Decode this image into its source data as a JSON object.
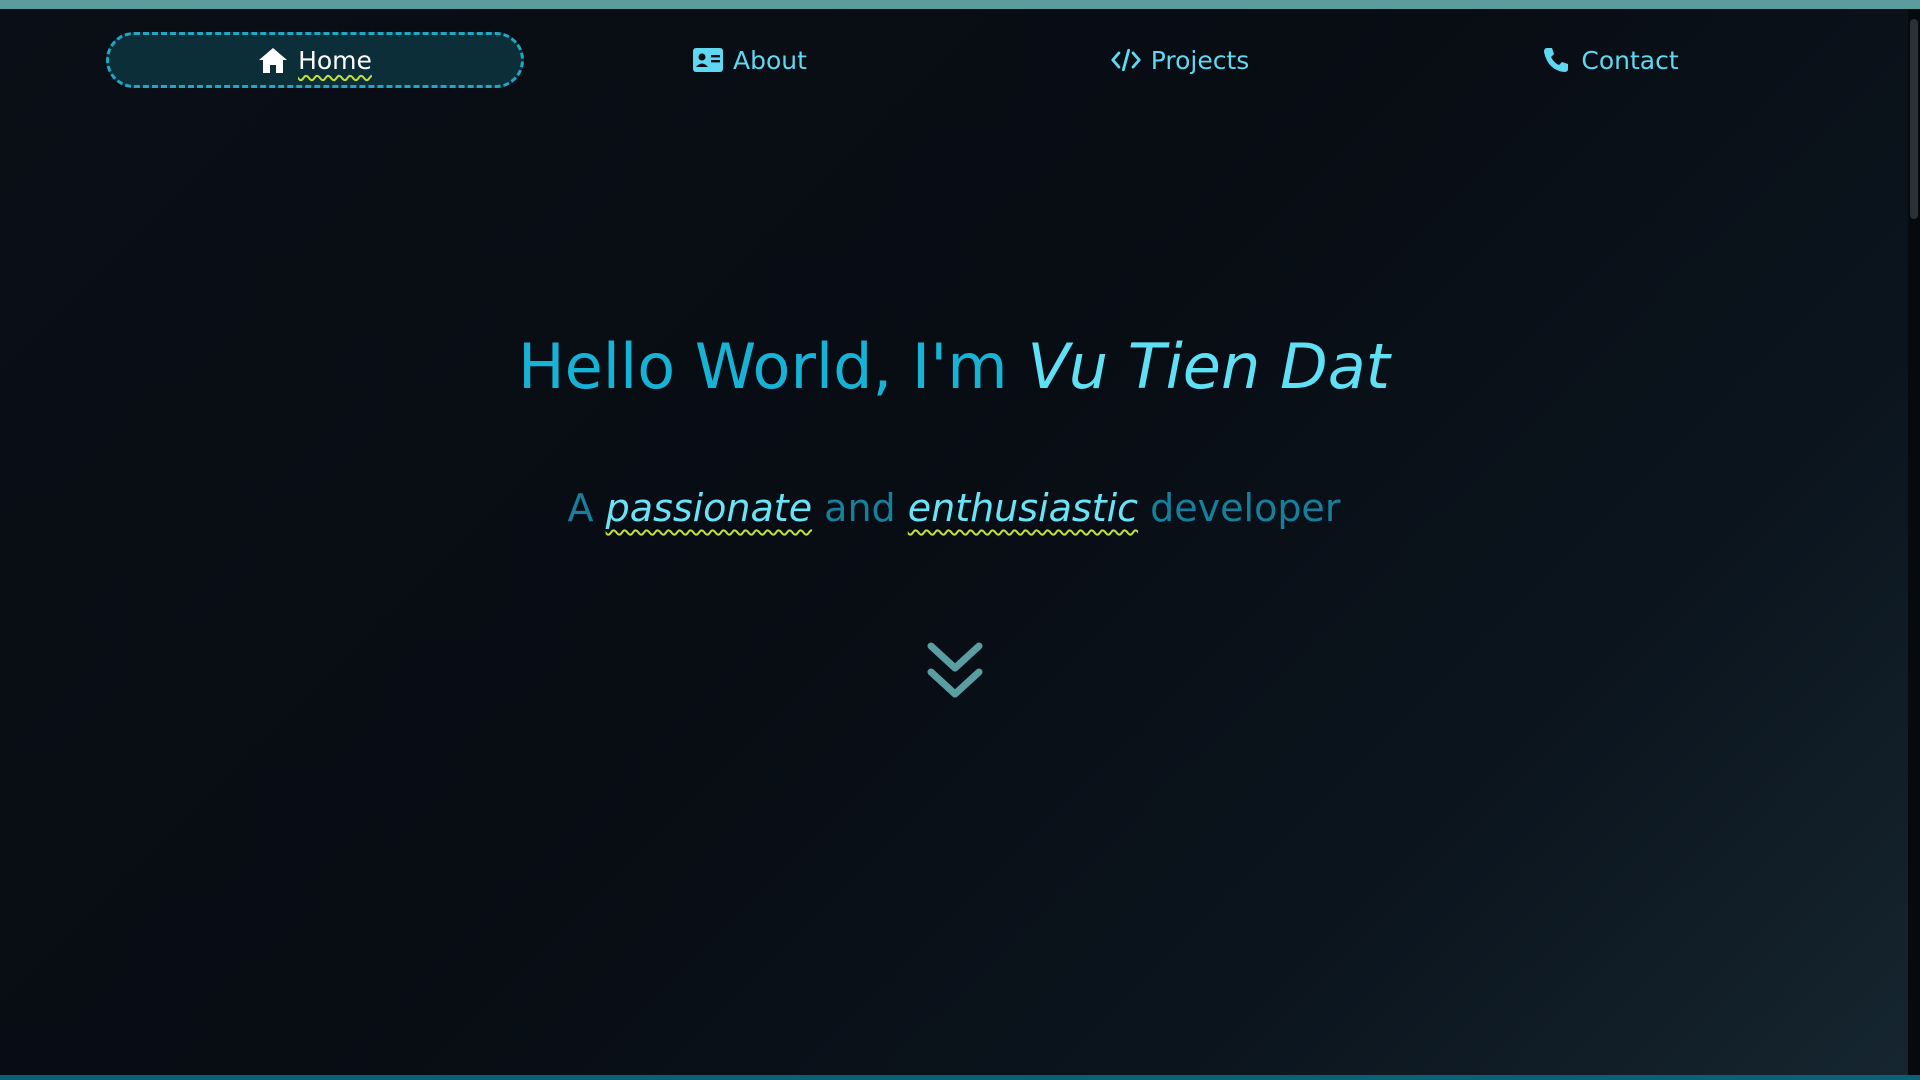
{
  "nav": {
    "items": [
      {
        "label": "Home",
        "icon": "home-icon",
        "active": true
      },
      {
        "label": "About",
        "icon": "id-card-icon",
        "active": false
      },
      {
        "label": "Projects",
        "icon": "code-icon",
        "active": false
      },
      {
        "label": "Contact",
        "icon": "phone-icon",
        "active": false
      }
    ]
  },
  "hero": {
    "title_prefix": "Hello World, I'm ",
    "name": "Vu Tien Dat",
    "sub_1": "A ",
    "highlight_1": "passionate",
    "sub_2": " and ",
    "highlight_2": "enthusiastic",
    "sub_3": " developer",
    "scroll_icon": "chevron-double-down-icon"
  },
  "colors": {
    "accent": "#17b3d6",
    "accent_light": "#5fe0f5",
    "underline": "#c5e03b",
    "background": "#0a0e15"
  }
}
